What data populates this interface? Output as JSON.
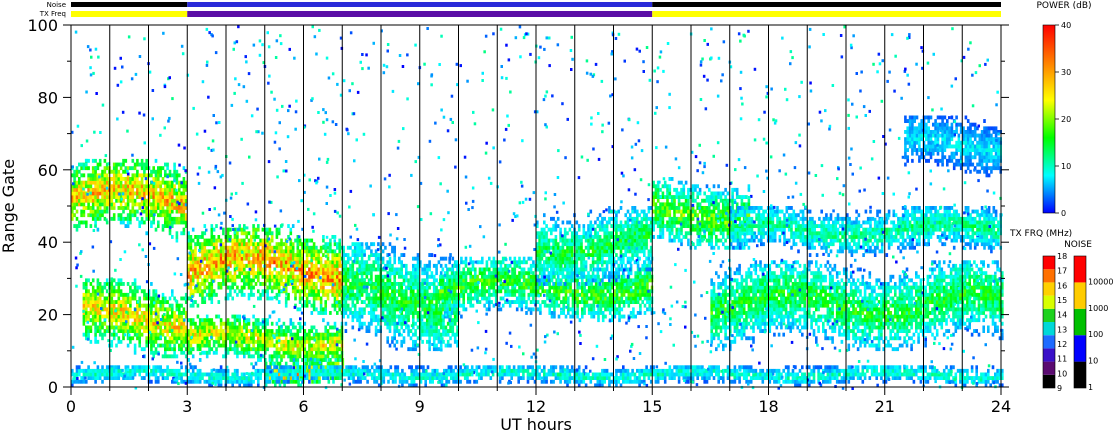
{
  "chart_data": {
    "type": "heatmap",
    "xlabel": "UT hours",
    "ylabel": "Range Gate",
    "xlim": [
      0,
      24
    ],
    "ylim": [
      0,
      100
    ],
    "xticks": [
      "0",
      "3",
      "6",
      "9",
      "12",
      "15",
      "18",
      "21",
      "24"
    ],
    "yticks": [
      "0",
      "20",
      "40",
      "60",
      "80",
      "100"
    ],
    "grid": "vertical lines every 1 hour",
    "header_bars": {
      "noise_label": "Noise",
      "txfreq_label": "TX Freq",
      "txfreq_segments": [
        {
          "start": 0,
          "end": 3,
          "color": "#ffff00"
        },
        {
          "start": 3,
          "end": 15,
          "color": "#5a0ea6"
        },
        {
          "start": 15,
          "end": 24,
          "color": "#ffff00"
        }
      ],
      "noise_segments": [
        {
          "start": 0,
          "end": 3,
          "color": "#000000"
        },
        {
          "start": 3,
          "end": 15,
          "color": "#2a2ad8"
        },
        {
          "start": 15,
          "end": 24,
          "color": "#000000"
        }
      ]
    },
    "colorbars": {
      "power": {
        "title": "POWER (dB)",
        "range": [
          0,
          40
        ],
        "ticks": [
          "0",
          "10",
          "20",
          "30",
          "40"
        ],
        "stops": [
          "#0000ff",
          "#00ffff",
          "#00ff00",
          "#ffff00",
          "#ff8000",
          "#ff0000"
        ]
      },
      "txfreq": {
        "title": "TX FRQ (MHz)",
        "ticks": [
          "9",
          "10",
          "11",
          "12",
          "13",
          "14",
          "15",
          "16",
          "17",
          "18"
        ],
        "colors": [
          "#000000",
          "#5a0a70",
          "#3a10c8",
          "#1e6bff",
          "#00d8d8",
          "#1ed21e",
          "#d8ff00",
          "#ffd000",
          "#ff7000",
          "#ff0000"
        ]
      },
      "noise": {
        "title": "NOISE",
        "ticks": [
          "1",
          "10",
          "100",
          "1000",
          "10000"
        ],
        "colors": [
          "#000000",
          "#0000ff",
          "#00c000",
          "#ffcc00",
          "#ff0000"
        ]
      }
    },
    "bands": [
      {
        "t0": 0.0,
        "t1": 3.0,
        "g0": 40,
        "g1": 63,
        "peak": 33
      },
      {
        "t0": 0.3,
        "t1": 3.0,
        "g0": 8,
        "g1": 30,
        "peak": 30
      },
      {
        "t0": 3.0,
        "t1": 7.0,
        "g0": 20,
        "g1": 45,
        "peak": 35
      },
      {
        "t0": 3.0,
        "t1": 7.0,
        "g0": 5,
        "g1": 20,
        "peak": 28
      },
      {
        "t0": 5.0,
        "t1": 7.0,
        "g0": 0,
        "g1": 8,
        "peak": 34
      },
      {
        "t0": 7.0,
        "t1": 10.0,
        "g0": 10,
        "g1": 40,
        "peak": 18
      },
      {
        "t0": 9.5,
        "t1": 15.0,
        "g0": 18,
        "g1": 36,
        "peak": 20
      },
      {
        "t0": 12.0,
        "t1": 15.0,
        "g0": 28,
        "g1": 50,
        "peak": 17
      },
      {
        "t0": 15.0,
        "t1": 17.5,
        "g0": 38,
        "g1": 58,
        "peak": 22
      },
      {
        "t0": 16.5,
        "t1": 24.0,
        "g0": 10,
        "g1": 35,
        "peak": 18
      },
      {
        "t0": 17.0,
        "t1": 24.0,
        "g0": 36,
        "g1": 50,
        "peak": 14
      },
      {
        "t0": 21.5,
        "t1": 24.0,
        "g0": 58,
        "g1": 75,
        "peak": 9
      },
      {
        "t0": 0.0,
        "t1": 24.0,
        "g0": 0,
        "g1": 6,
        "peak": 12
      }
    ]
  }
}
